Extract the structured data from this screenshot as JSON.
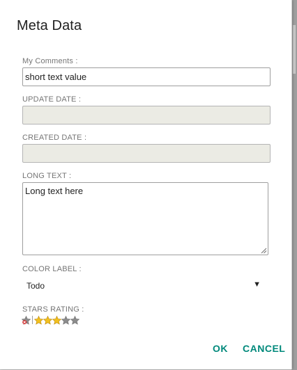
{
  "dialog": {
    "title": "Meta Data",
    "fields": {
      "comments": {
        "label": "My Comments :",
        "value": "short text value"
      },
      "update_date": {
        "label": "UPDATE DATE :",
        "value": ""
      },
      "created_date": {
        "label": "CREATED DATE :",
        "value": ""
      },
      "long_text": {
        "label": "LONG TEXT :",
        "value": "Long text here"
      },
      "color_label": {
        "label": "COLOR LABEL :",
        "selected": "Todo",
        "arrow": "▼"
      },
      "stars_rating": {
        "label": "STARS RATING :",
        "rating": 3,
        "max": 5
      }
    },
    "buttons": {
      "ok": "OK",
      "cancel": "CANCEL"
    }
  },
  "colors": {
    "accent": "#00897b",
    "label": "#757575",
    "star_filled": "#f2c01e",
    "star_empty": "#8c8c8c",
    "disabled_bg": "#ebebe4"
  },
  "icons": {
    "cancel_rating": "cancel-rating-icon",
    "star": "star-icon",
    "dropdown": "dropdown-arrow-icon",
    "resize": "resize-grip-icon"
  }
}
